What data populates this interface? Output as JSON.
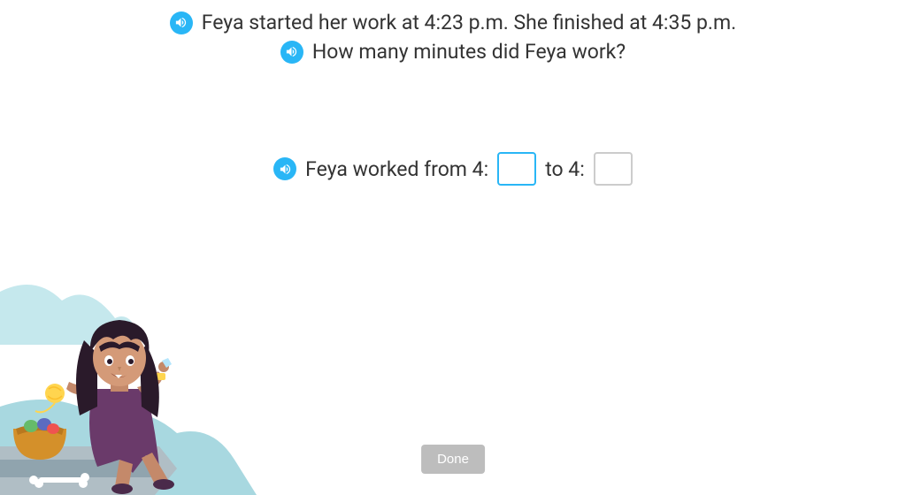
{
  "question": {
    "line1": "Feya started her work at 4:23 p.m. She finished at 4:35 p.m.",
    "line2": "How many minutes did Feya work?"
  },
  "answer": {
    "prefix": "Feya worked from 4:",
    "mid": " to 4:",
    "input1_value": "",
    "input2_value": ""
  },
  "buttons": {
    "done": "Done"
  }
}
